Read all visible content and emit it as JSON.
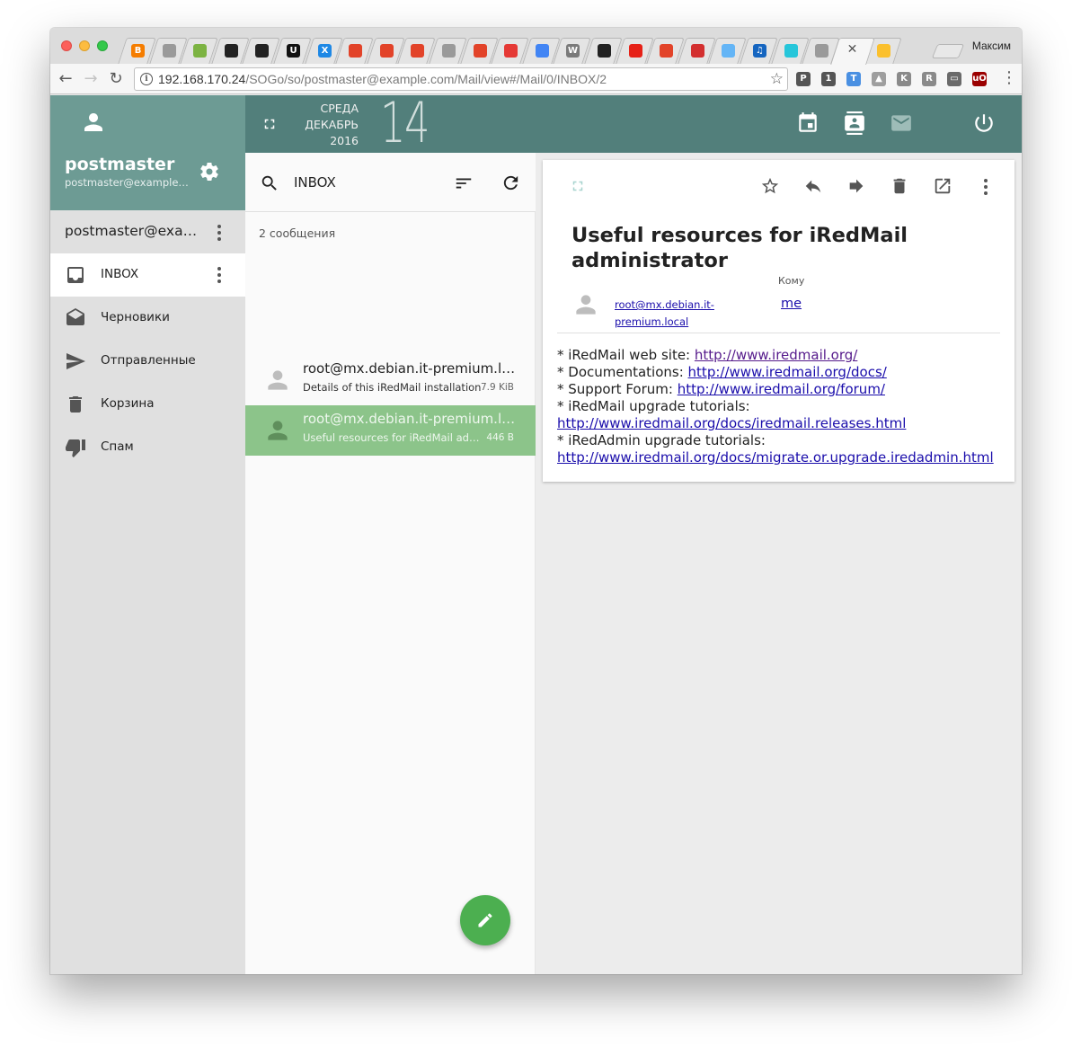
{
  "browser": {
    "profile_name": "Максим",
    "url_host": "192.168.170.24",
    "url_path": "/SOGo/so/postmaster@example.com/Mail/view#/Mail/0/INBOX/2",
    "tabs": [
      {
        "icon": "blogger-icon",
        "color": "#f57d00",
        "glyph": "B"
      },
      {
        "icon": "page-icon",
        "color": "#9a9a9a",
        "glyph": ""
      },
      {
        "icon": "green-leaf-icon",
        "color": "#7cb342",
        "glyph": ""
      },
      {
        "icon": "github-icon",
        "color": "#222222",
        "glyph": ""
      },
      {
        "icon": "github-icon",
        "color": "#222222",
        "glyph": ""
      },
      {
        "icon": "u-icon",
        "color": "#111111",
        "glyph": "U"
      },
      {
        "icon": "x-logo-icon",
        "color": "#1e88e5",
        "glyph": "X"
      },
      {
        "icon": "gitlab-icon",
        "color": "#e24329",
        "glyph": ""
      },
      {
        "icon": "gitlab-icon",
        "color": "#e24329",
        "glyph": ""
      },
      {
        "icon": "gitlab-icon",
        "color": "#e24329",
        "glyph": ""
      },
      {
        "icon": "page-icon",
        "color": "#9a9a9a",
        "glyph": ""
      },
      {
        "icon": "gitlab-icon",
        "color": "#e24329",
        "glyph": ""
      },
      {
        "icon": "red-circle-icon",
        "color": "#e53935",
        "glyph": ""
      },
      {
        "icon": "docs-icon",
        "color": "#4285f4",
        "glyph": ""
      },
      {
        "icon": "wordpress-icon",
        "color": "#7a7a7a",
        "glyph": "W"
      },
      {
        "icon": "github-icon",
        "color": "#222222",
        "glyph": ""
      },
      {
        "icon": "youtube-icon",
        "color": "#e62117",
        "glyph": ""
      },
      {
        "icon": "gitlab-icon",
        "color": "#e24329",
        "glyph": ""
      },
      {
        "icon": "red-envelope-icon",
        "color": "#d32f2f",
        "glyph": ""
      },
      {
        "icon": "mail-icon",
        "color": "#64b5f6",
        "glyph": ""
      },
      {
        "icon": "music-note-icon",
        "color": "#1565c0",
        "glyph": "♫"
      },
      {
        "icon": "cyan-circle-icon",
        "color": "#26c6da",
        "glyph": ""
      },
      {
        "icon": "page-icon",
        "color": "#9a9a9a",
        "glyph": ""
      },
      {
        "icon": "green-ring-icon",
        "color": "#2e7d32",
        "glyph": ""
      },
      {
        "icon": "yellow-face-icon",
        "color": "#fbc02d",
        "glyph": ""
      }
    ],
    "extensions": [
      {
        "icon": "pocket-icon",
        "color": "#555555",
        "glyph": "P"
      },
      {
        "icon": "1password-icon",
        "color": "#555555",
        "glyph": "1"
      },
      {
        "icon": "translate-icon",
        "color": "#4a90e2",
        "glyph": "T"
      },
      {
        "icon": "drive-icon",
        "color": "#9e9e9e",
        "glyph": "▲"
      },
      {
        "icon": "k-icon",
        "color": "#8a8a8a",
        "glyph": "K"
      },
      {
        "icon": "r-icon",
        "color": "#8a8a8a",
        "glyph": "R"
      },
      {
        "icon": "cast-icon",
        "color": "#6a6a6a",
        "glyph": "▭"
      },
      {
        "icon": "ublock-icon",
        "color": "#9b0000",
        "glyph": "uO"
      }
    ]
  },
  "sidebar": {
    "user_name": "postmaster",
    "user_email": "postmaster@example.com",
    "account_label": "postmaster@example.com",
    "folders": [
      {
        "label": "INBOX",
        "icon": "inbox-icon",
        "active": true
      },
      {
        "label": "Черновики",
        "icon": "drafts-icon",
        "active": false
      },
      {
        "label": "Отправленные",
        "icon": "send-icon",
        "active": false
      },
      {
        "label": "Корзина",
        "icon": "trash-icon",
        "active": false
      },
      {
        "label": "Спам",
        "icon": "thumbs-down-icon",
        "active": false
      }
    ]
  },
  "header": {
    "weekday": "СРЕДА",
    "month": "ДЕКАБРЬ",
    "year": "2016",
    "day": "14"
  },
  "message_list": {
    "folder_title": "INBOX",
    "count_text": "2 сообщения",
    "messages": [
      {
        "sender": "root@mx.debian.it-premium.local",
        "subject": "Details of this iRedMail installation",
        "size": "7.9 KiB",
        "selected": false
      },
      {
        "sender": "root@mx.debian.it-premium.local",
        "subject": "Useful resources for iRedMail administrator",
        "size": "446 B",
        "selected": true
      }
    ]
  },
  "reader": {
    "subject": "Useful resources for iRedMail administrator",
    "from": "root@mx.debian.it-premium.local",
    "to_label": "Кому",
    "to": "me",
    "body": [
      {
        "prefix": "* iRedMail web site: ",
        "link": "http://www.iredmail.org/",
        "visited": true
      },
      {
        "prefix": "* Documentations: ",
        "link": "http://www.iredmail.org/docs/",
        "visited": false
      },
      {
        "prefix": "* Support Forum: ",
        "link": "http://www.iredmail.org/forum/",
        "visited": false
      },
      {
        "prefix": "* iRedMail upgrade tutorials:",
        "link": "",
        "visited": false
      },
      {
        "prefix": "",
        "link": "http://www.iredmail.org/docs/iredmail.releases.html",
        "visited": false
      },
      {
        "prefix": "* iRedAdmin upgrade tutorials:",
        "link": "",
        "visited": false
      },
      {
        "prefix": "",
        "link": "http://www.iredmail.org/docs/migrate.or.upgrade.iredadmin.html",
        "visited": false
      }
    ]
  },
  "colors": {
    "sidebar_header": "#6d9b94",
    "top_bar": "#527f7b",
    "selected_row": "#8cc48a",
    "fab": "#4caf50"
  }
}
